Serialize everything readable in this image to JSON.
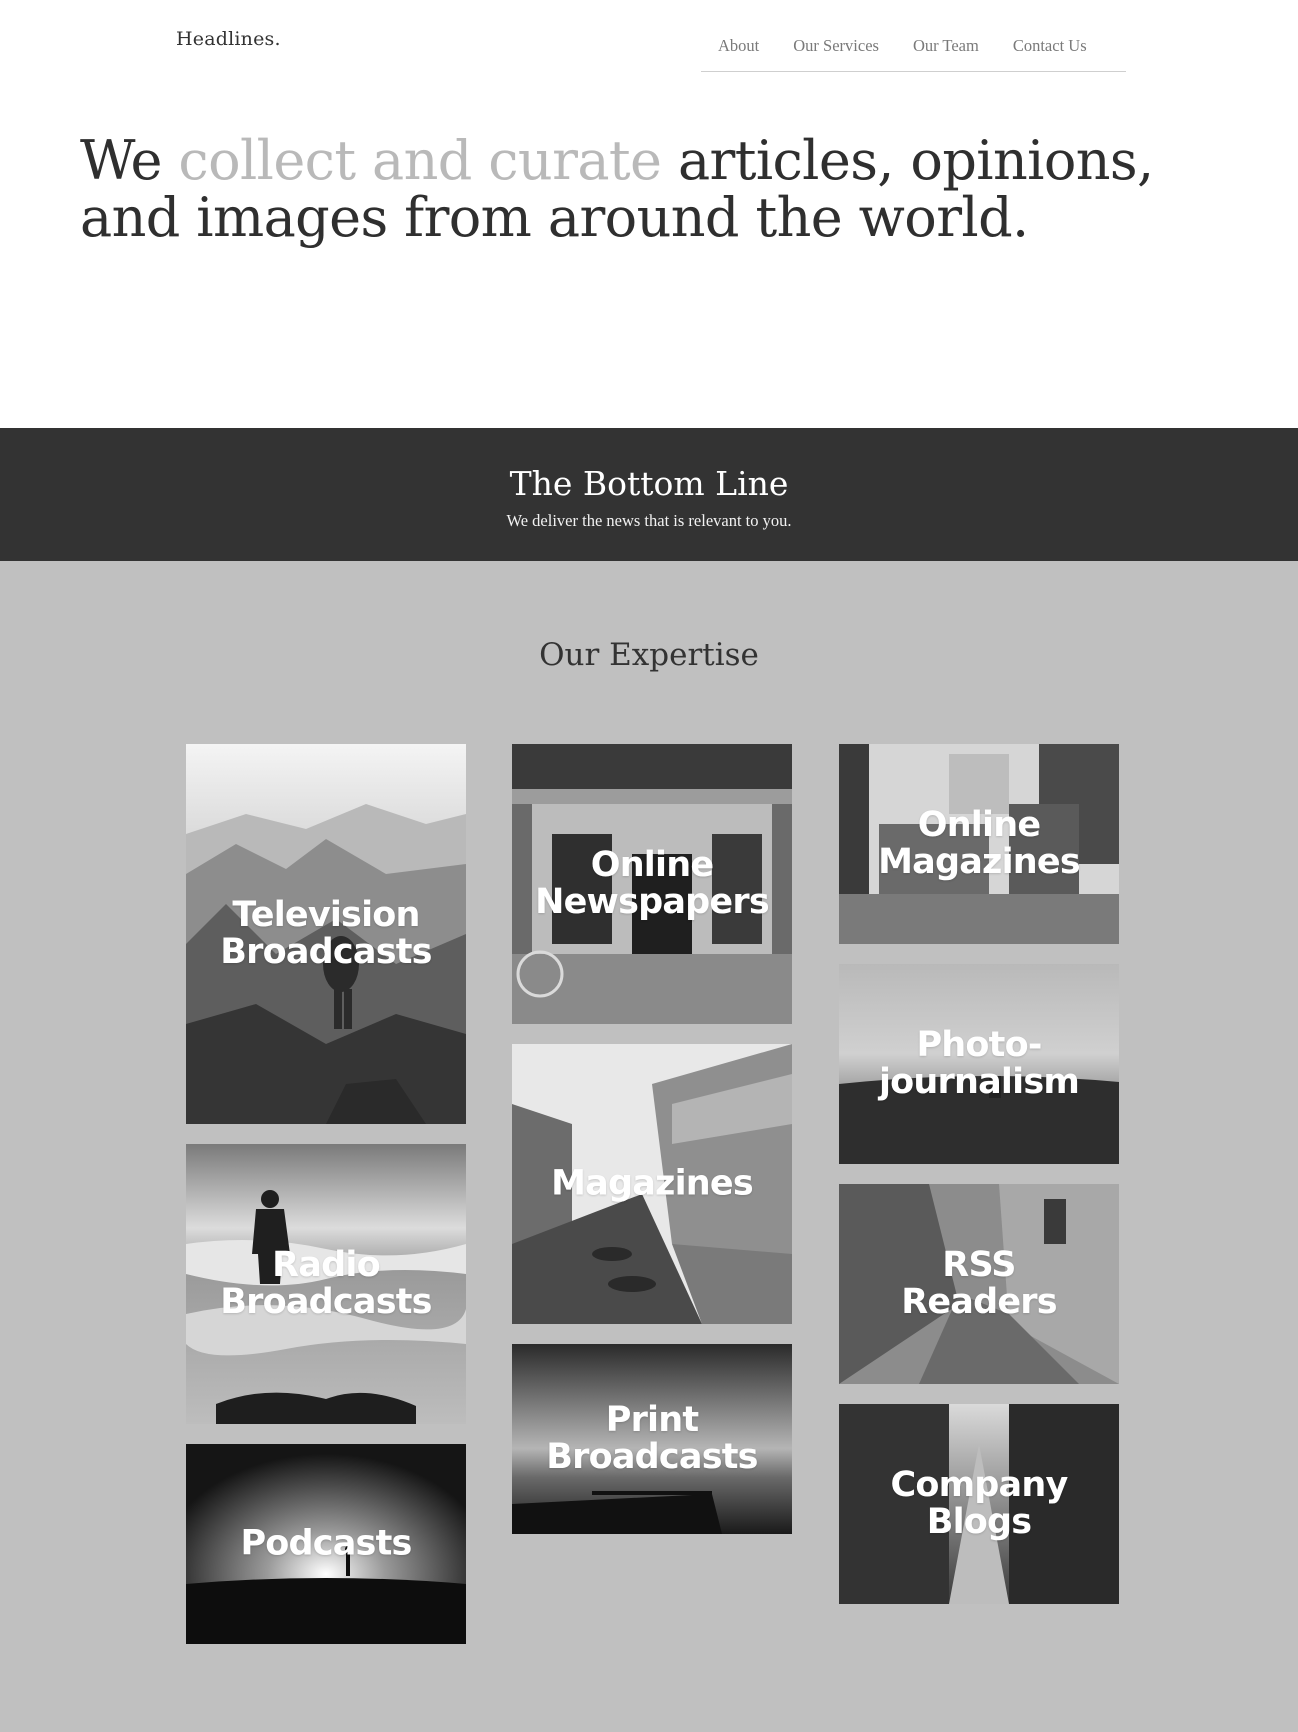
{
  "header": {
    "brand": "Headlines.",
    "nav": [
      "About",
      "Our Services",
      "Our Team",
      "Contact Us"
    ]
  },
  "hero": {
    "part1": "We ",
    "highlight": "collect and curate",
    "part2": " articles, opinions, and images from around the world."
  },
  "band": {
    "title": "The Bottom Line",
    "subtitle": "We deliver the news that is relevant to you."
  },
  "expertise": {
    "title": "Our Expertise",
    "tiles": [
      {
        "label": "Television\nBroadcasts",
        "scene": "mountain-hiker"
      },
      {
        "label": "Radio\nBroadcasts",
        "scene": "beach-man"
      },
      {
        "label": "Podcasts",
        "scene": "silhouette-hill"
      },
      {
        "label": "Online\nNewspapers",
        "scene": "shop-bicycle"
      },
      {
        "label": "Magazines",
        "scene": "canal-boats"
      },
      {
        "label": "Print\nBroadcasts",
        "scene": "pier-sunset"
      },
      {
        "label": "Online\nMagazines",
        "scene": "tram-street"
      },
      {
        "label": "Photo-\njournalism",
        "scene": "field-runner"
      },
      {
        "label": "RSS\nReaders",
        "scene": "alley-cobbles"
      },
      {
        "label": "Company\nBlogs",
        "scene": "street-light"
      }
    ]
  }
}
